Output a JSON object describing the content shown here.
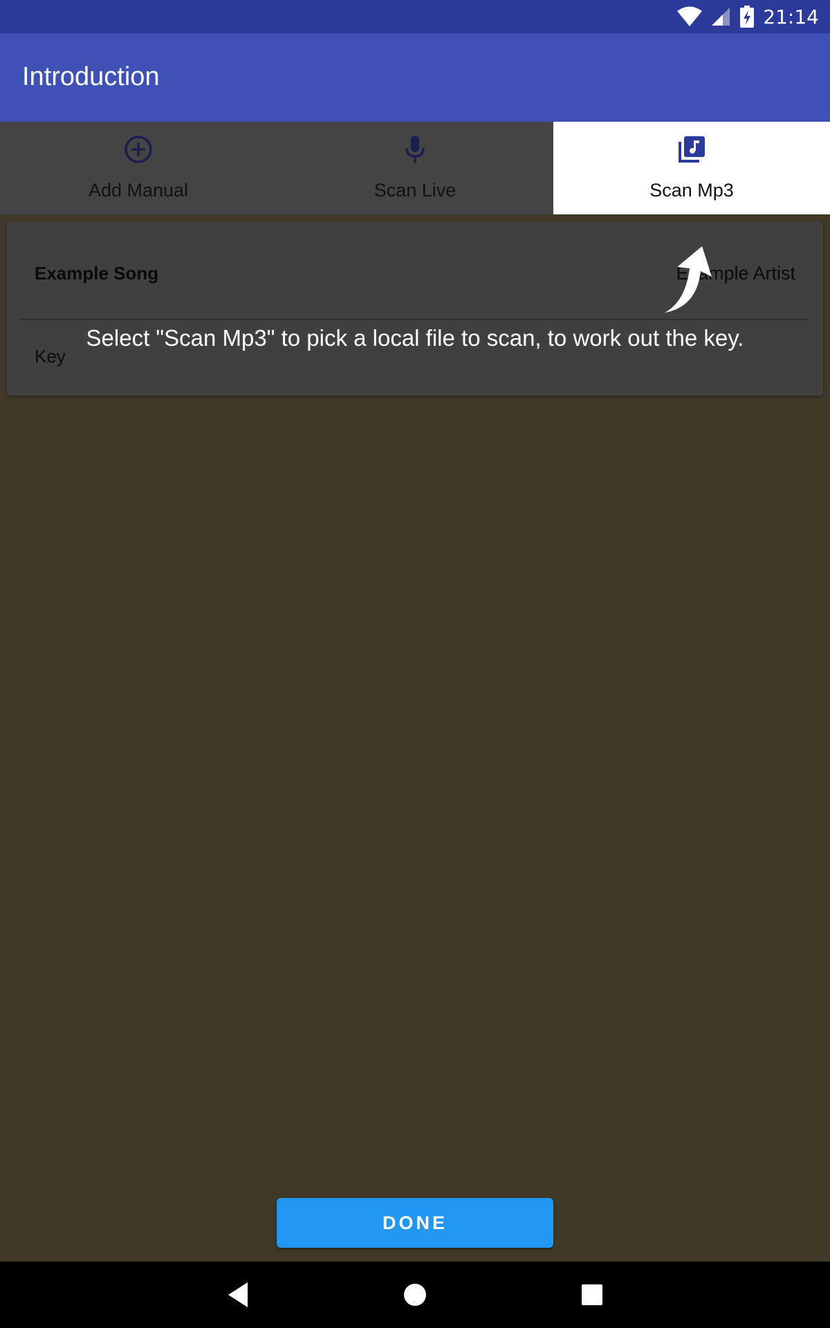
{
  "status_bar": {
    "time": "21:14",
    "icons": [
      "wifi-icon",
      "signal-icon",
      "battery-charging-icon"
    ],
    "color": "#2c3a9c"
  },
  "app_bar": {
    "title": "Introduction",
    "color": "#3f51b5"
  },
  "tabs": [
    {
      "label": "Add Manual",
      "icon": "add-circle-icon",
      "active": false
    },
    {
      "label": "Scan Live",
      "icon": "microphone-icon",
      "active": false
    },
    {
      "label": "Scan Mp3",
      "icon": "music-library-icon",
      "active": true
    }
  ],
  "song_card": {
    "title": "Example Song",
    "artist": "Example Artist",
    "key_label": "Key"
  },
  "tooltip": {
    "text": "Select \"Scan Mp3\" to pick a local file to scan, to work out the key."
  },
  "done_button": {
    "label": "DONE",
    "color": "#2196f3"
  },
  "nav_bar": {
    "buttons": [
      "back-icon",
      "home-icon",
      "recents-icon"
    ]
  }
}
